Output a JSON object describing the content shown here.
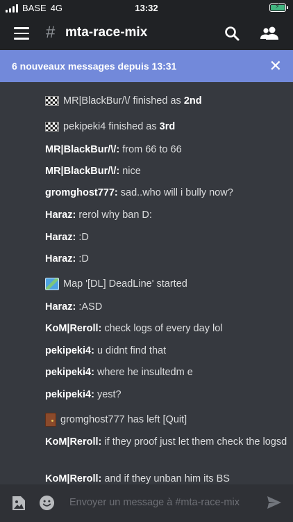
{
  "status_bar": {
    "carrier": "BASE",
    "network": "4G",
    "time": "13:32"
  },
  "header": {
    "hash": "#",
    "channel": "mta-race-mix"
  },
  "banner": {
    "text": "6 nouveaux messages depuis 13:31",
    "close": "✕"
  },
  "messages": [
    {
      "type": "system",
      "icon": "checkered-flag-icon",
      "pre": "MR|BlackBur/\\/ finished as ",
      "bold": "2nd"
    },
    {
      "type": "system",
      "icon": "checkered-flag-icon",
      "pre": "pekipeki4 finished as ",
      "bold": "3rd"
    },
    {
      "type": "chat",
      "author": "MR|BlackBur/\\/:",
      "text": " from 66 to 66"
    },
    {
      "type": "chat",
      "author": "MR|BlackBur/\\/:",
      "text": " nice"
    },
    {
      "type": "chat",
      "author": "gromghost777:",
      "text": " sad..who will i bully now?"
    },
    {
      "type": "chat",
      "author": "Haraz:",
      "text": " rerol why ban D:"
    },
    {
      "type": "chat",
      "author": "Haraz:",
      "text": " :D"
    },
    {
      "type": "chat",
      "author": "Haraz:",
      "text": " :D"
    },
    {
      "type": "system",
      "icon": "map-icon",
      "pre": "Map '[DL] DeadLine' started",
      "bold": ""
    },
    {
      "type": "chat",
      "author": "Haraz:",
      "text": " :ASD"
    },
    {
      "type": "chat",
      "author": "KoM|Reroll:",
      "text": " check logs of every day lol"
    },
    {
      "type": "chat",
      "author": "pekipeki4:",
      "text": " u didnt find that"
    },
    {
      "type": "chat",
      "author": "pekipeki4:",
      "text": " where he insultedm e"
    },
    {
      "type": "chat",
      "author": "pekipeki4:",
      "text": " yest?"
    },
    {
      "type": "system",
      "icon": "door-icon",
      "pre": "gromghost777 has left [Quit]",
      "bold": ""
    },
    {
      "type": "chat",
      "author": "KoM|Reroll:",
      "text": " if they proof just let them check the logsd"
    },
    {
      "type": "chat",
      "author": "KoM|Reroll:",
      "text": " and if they unban him its BS"
    }
  ],
  "input": {
    "placeholder": "Envoyer un message à #mta-race-mix"
  },
  "colors": {
    "background": "#36393f",
    "header": "#202225",
    "banner": "#7289da",
    "input_bar": "#2f3136"
  }
}
